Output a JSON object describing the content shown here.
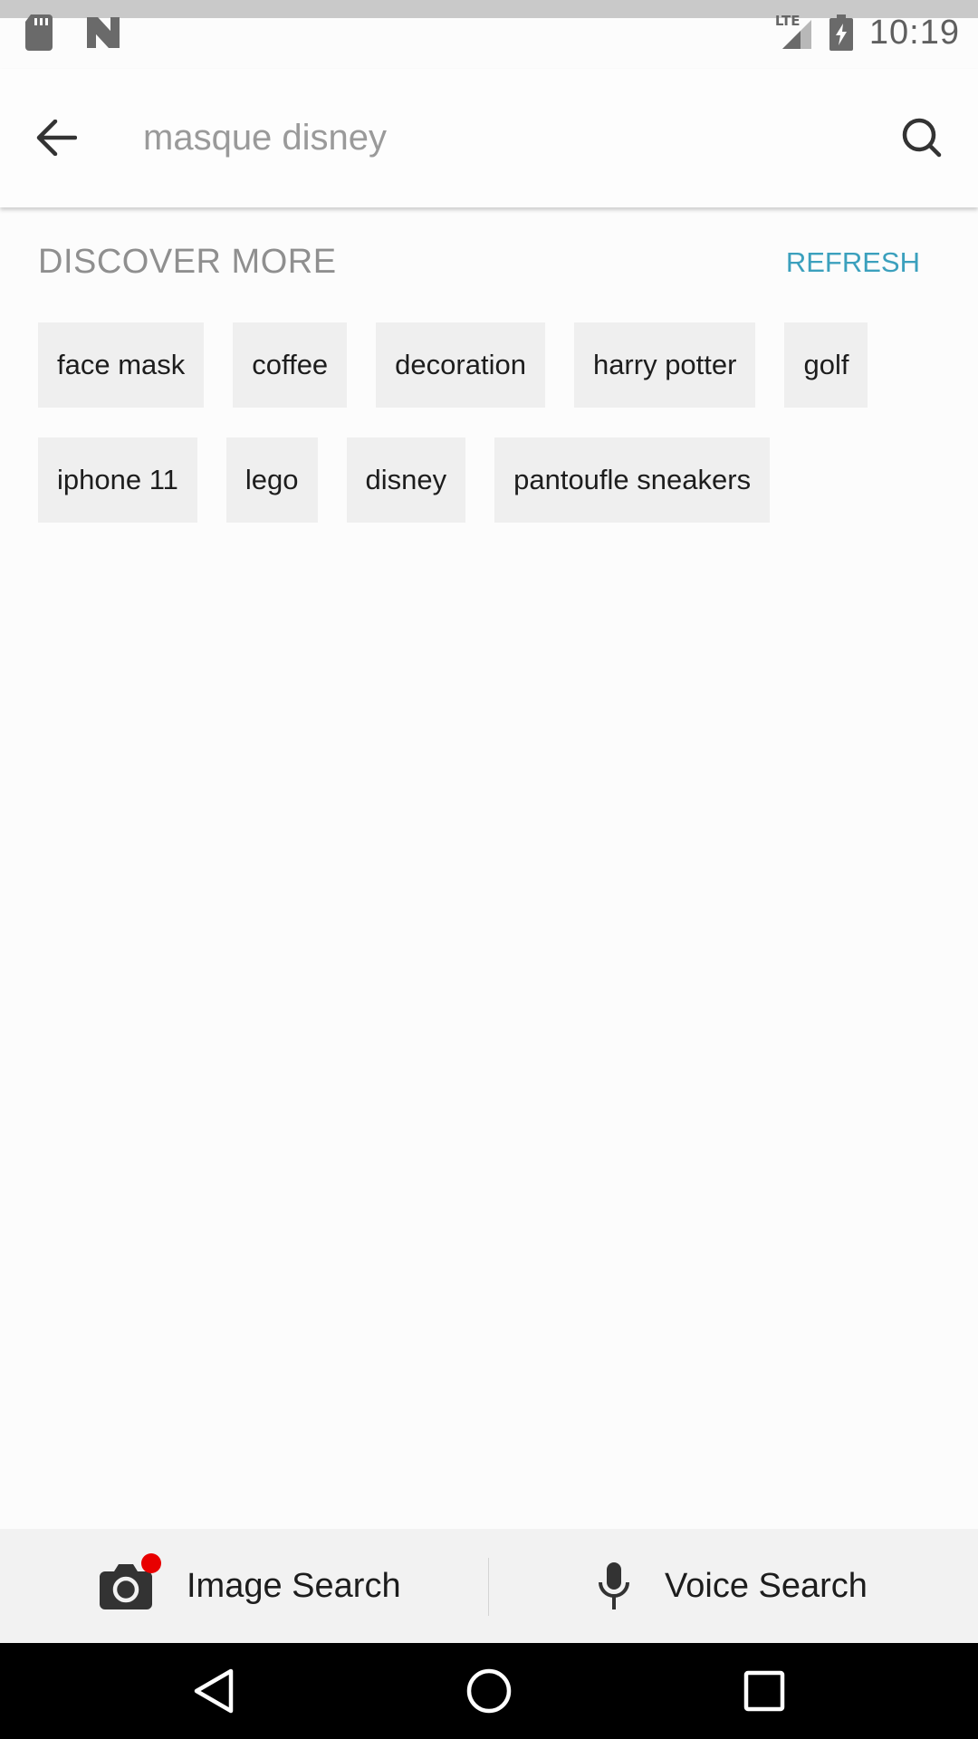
{
  "status_bar": {
    "time": "10:19",
    "network": "LTE",
    "left_icons": [
      "sd-card-icon",
      "n-logo-icon"
    ],
    "right_icons": [
      "signal-icon",
      "battery-charging-icon"
    ]
  },
  "search": {
    "back_icon": "back-arrow-icon",
    "query": "masque disney",
    "search_icon": "search-icon"
  },
  "discover": {
    "title": "DISCOVER MORE",
    "refresh_label": "REFRESH",
    "accent_color": "#3ba0bd",
    "rows": [
      [
        "face mask",
        "coffee",
        "decoration",
        "harry potter",
        "golf"
      ],
      [
        "iphone 11",
        "lego",
        "disney",
        "pantoufle sneakers"
      ]
    ]
  },
  "bottom_bar": {
    "image_search_label": "Image Search",
    "image_search_icon": "camera-icon",
    "voice_search_label": "Voice Search",
    "voice_search_icon": "microphone-icon",
    "notification_dot_color": "#e80000"
  },
  "nav_bar": {
    "buttons": [
      "back-triangle-icon",
      "home-circle-icon",
      "recents-square-icon"
    ]
  }
}
